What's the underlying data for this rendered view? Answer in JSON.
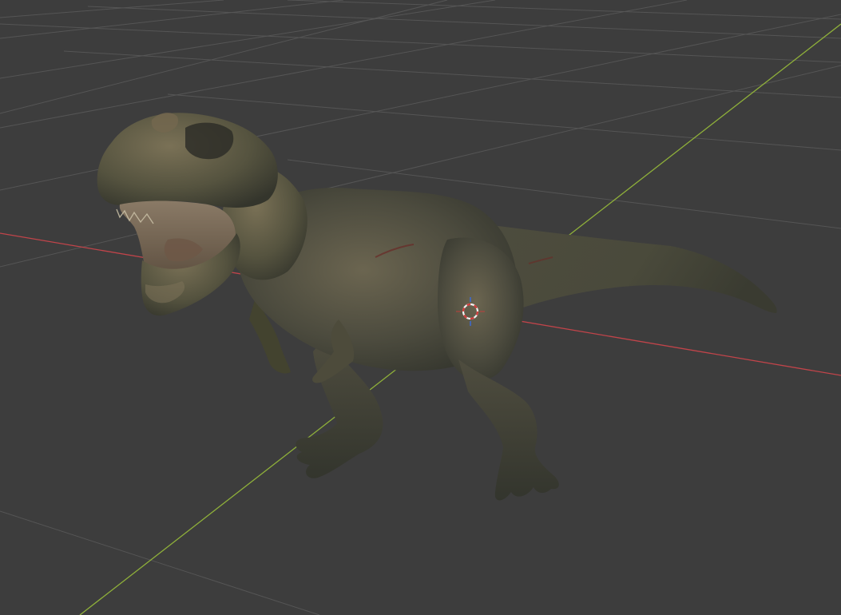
{
  "viewport": {
    "name": "3D Viewport",
    "background_color": "#3d3d3d",
    "grid_color": "#555555",
    "axis_x_color": "#c1444a",
    "axis_y_color": "#8fb03a"
  },
  "scene": {
    "object": "tyrannosaurus-model",
    "skin_colors": [
      "#4a4a3c",
      "#5b5844",
      "#36382f",
      "#6b6550"
    ],
    "icons": [
      "3d-cursor-icon"
    ]
  }
}
